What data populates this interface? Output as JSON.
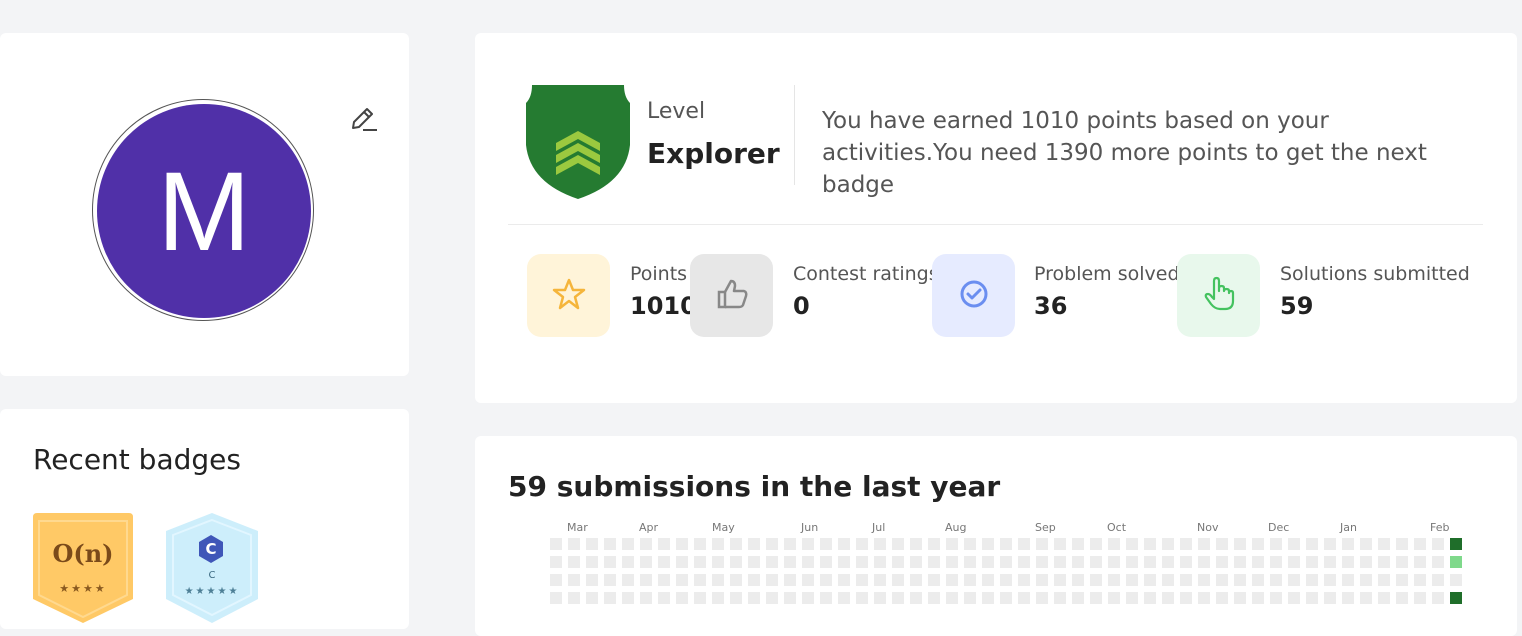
{
  "profile": {
    "avatar_initial": "M",
    "avatar_color": "#5030a8"
  },
  "badges": {
    "title": "Recent badges",
    "items": [
      {
        "text": "O(n)",
        "stars": "★★★★"
      },
      {
        "text": "C",
        "caption": "C",
        "stars": "★★★★★"
      }
    ]
  },
  "level": {
    "label": "Level",
    "name": "Explorer",
    "message": "You have earned 1010 points based on your activities.You need 1390 more points to get the next badge"
  },
  "stats": [
    {
      "label": "Points",
      "value": "1010",
      "icon": "star-icon",
      "bg": "#fff4d9"
    },
    {
      "label": "Contest ratings",
      "value": "0",
      "icon": "thumbs-up-icon",
      "bg": "#e7e7e7"
    },
    {
      "label": "Problem solved",
      "value": "36",
      "icon": "check-circle-icon",
      "bg": "#e6ebff"
    },
    {
      "label": "Solutions submitted",
      "value": "59",
      "icon": "pointer-hand-icon",
      "bg": "#e8f8ec"
    }
  ],
  "activity": {
    "title": "59 submissions in the last year",
    "months": [
      "Mar",
      "Apr",
      "May",
      "Jun",
      "Jul",
      "Aug",
      "Sep",
      "Oct",
      "Nov",
      "Dec",
      "Jan",
      "Feb"
    ],
    "colors": {
      "empty": "#ececec",
      "low": "#7fd98b",
      "high": "#1f6e2a"
    }
  }
}
